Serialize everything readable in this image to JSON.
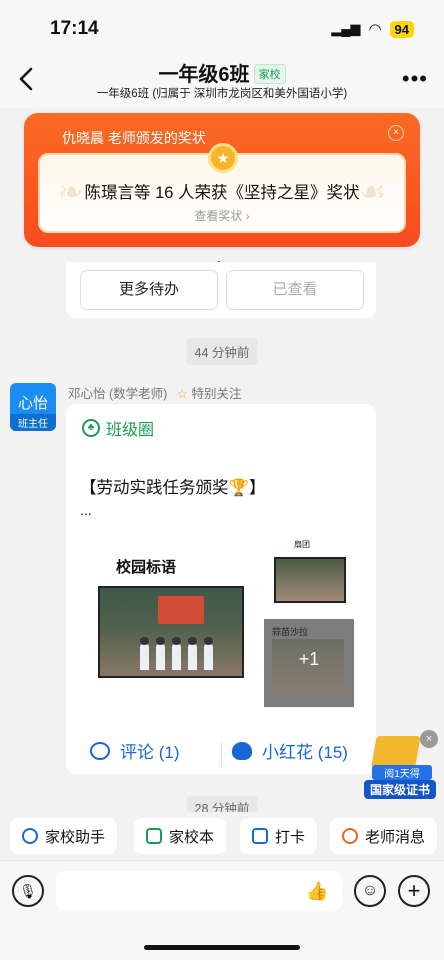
{
  "status": {
    "time": "17:14",
    "battery": "94"
  },
  "nav": {
    "title": "一年级6班",
    "badge": "家校",
    "subtitle": "一年级6班 (归属于 深圳市龙岗区和美外国语小学)"
  },
  "award": {
    "from": "仇晓晨 老师颁发的奖状",
    "text": "陈璟言等 16 人荣获《坚持之星》奖状",
    "link": "查看奖状 ›"
  },
  "todo": {
    "more_label": "更多待办",
    "seen_label": "已查看"
  },
  "times": {
    "t1": "44 分钟前",
    "t2": "28 分钟前"
  },
  "sender": {
    "avatar_name": "心怡",
    "avatar_role": "班主任",
    "name": "邓心怡 (数学老师)",
    "follow": "特别关注"
  },
  "post": {
    "source": "班级圈",
    "title": "【劳动实践任务颁奖🏆】",
    "ellipsis": "...",
    "photo1_label": "校园标语",
    "photo2_label": "扇团",
    "photo3_label": "蒜苗沙拉",
    "more_count": "+1",
    "comment": "评论 (1)",
    "flower": "小红花 (15)"
  },
  "promo": {
    "line1": "阅1天得",
    "line2": "国家级证书"
  },
  "quickbar": [
    {
      "label": "家校助手",
      "color": "#1768d4"
    },
    {
      "label": "家校本",
      "color": "#1a9a54"
    },
    {
      "label": "打卡",
      "color": "#1768d4"
    },
    {
      "label": "老师消息",
      "color": "#f26322"
    }
  ],
  "input": {
    "placeholder": ""
  }
}
